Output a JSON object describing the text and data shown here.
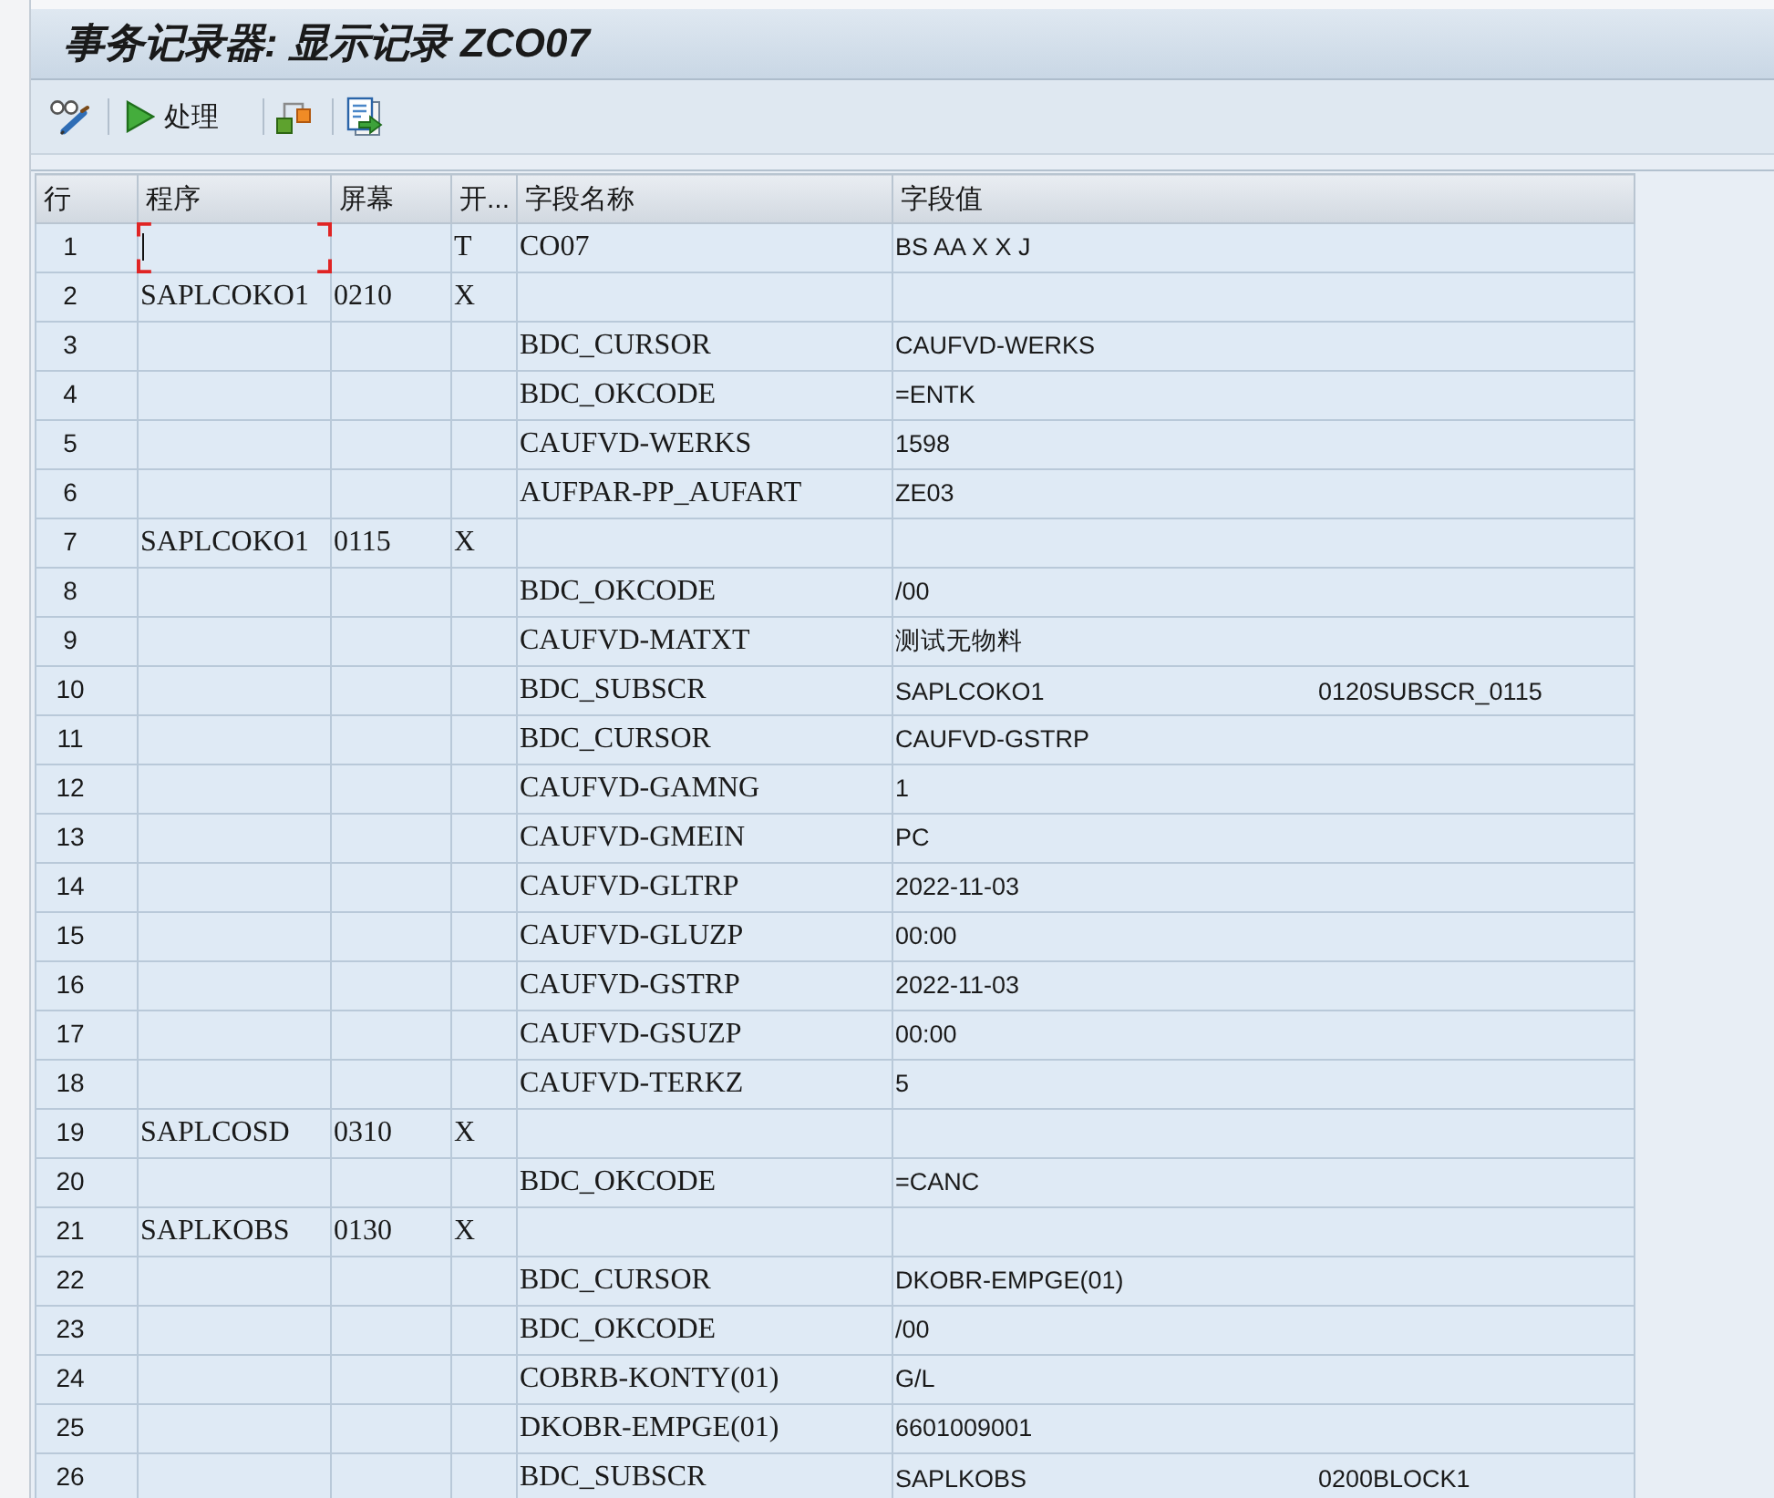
{
  "window": {
    "title": "事务记录器: 显示记录 ZCO07"
  },
  "toolbar": {
    "process_button": "处理"
  },
  "table": {
    "columns": [
      "行",
      "程序",
      "屏幕",
      "开...",
      "字段名称",
      "字段值"
    ],
    "rows": [
      {
        "line": "1",
        "column_4": "T",
        "field_name": "CO07",
        "field_value": "BS AA X X J",
        "focused": true
      },
      {
        "line": "2",
        "program": "SAPLCOKO1",
        "screen": "0210",
        "column_4": "X",
        "focused": false
      },
      {
        "line": "3",
        "field_name": "BDC_CURSOR",
        "field_value": "CAUFVD-WERKS",
        "focused": false
      },
      {
        "line": "4",
        "field_name": "BDC_OKCODE",
        "field_value": "=ENTK",
        "focused": false
      },
      {
        "line": "5",
        "field_name": "CAUFVD-WERKS",
        "field_value": "1598",
        "focused": false
      },
      {
        "line": "6",
        "field_name": "AUFPAR-PP_AUFART",
        "field_value": "ZE03",
        "focused": false
      },
      {
        "line": "7",
        "program": "SAPLCOKO1",
        "screen": "0115",
        "column_4": "X",
        "focused": false
      },
      {
        "line": "8",
        "field_name": "BDC_OKCODE",
        "field_value": "/00",
        "focused": false
      },
      {
        "line": "9",
        "field_name": "CAUFVD-MATXT",
        "field_value": "测试无物料",
        "focused": false
      },
      {
        "line": "10",
        "field_name": "BDC_SUBSCR",
        "field_value": "SAPLCOKO1",
        "field_value_2": "0120SUBSCR_0115",
        "focused": false
      },
      {
        "line": "11",
        "field_name": "BDC_CURSOR",
        "field_value": "CAUFVD-GSTRP",
        "focused": false
      },
      {
        "line": "12",
        "field_name": "CAUFVD-GAMNG",
        "field_value": "1",
        "focused": false
      },
      {
        "line": "13",
        "field_name": "CAUFVD-GMEIN",
        "field_value": "PC",
        "focused": false
      },
      {
        "line": "14",
        "field_name": "CAUFVD-GLTRP",
        "field_value": "2022-11-03",
        "focused": false
      },
      {
        "line": "15",
        "field_name": "CAUFVD-GLUZP",
        "field_value": "00:00",
        "focused": false
      },
      {
        "line": "16",
        "field_name": "CAUFVD-GSTRP",
        "field_value": "2022-11-03",
        "focused": false
      },
      {
        "line": "17",
        "field_name": "CAUFVD-GSUZP",
        "field_value": "00:00",
        "focused": false
      },
      {
        "line": "18",
        "field_name": "CAUFVD-TERKZ",
        "field_value": "5",
        "focused": false
      },
      {
        "line": "19",
        "program": "SAPLCOSD",
        "screen": "0310",
        "column_4": "X",
        "focused": false
      },
      {
        "line": "20",
        "field_name": "BDC_OKCODE",
        "field_value": "=CANC",
        "focused": false
      },
      {
        "line": "21",
        "program": "SAPLKOBS",
        "screen": "0130",
        "column_4": "X",
        "focused": false
      },
      {
        "line": "22",
        "field_name": "BDC_CURSOR",
        "field_value": "DKOBR-EMPGE(01)",
        "focused": false
      },
      {
        "line": "23",
        "field_name": "BDC_OKCODE",
        "field_value": "/00",
        "focused": false
      },
      {
        "line": "24",
        "field_name": "COBRB-KONTY(01)",
        "field_value": "G/L",
        "focused": false
      },
      {
        "line": "25",
        "field_name": "DKOBR-EMPGE(01)",
        "field_value": "6601009001",
        "focused": false
      },
      {
        "line": "26",
        "field_name": "BDC_SUBSCR",
        "field_value": "SAPLKOBS",
        "field_value_2": "0200BLOCK1",
        "focused": false
      }
    ]
  }
}
